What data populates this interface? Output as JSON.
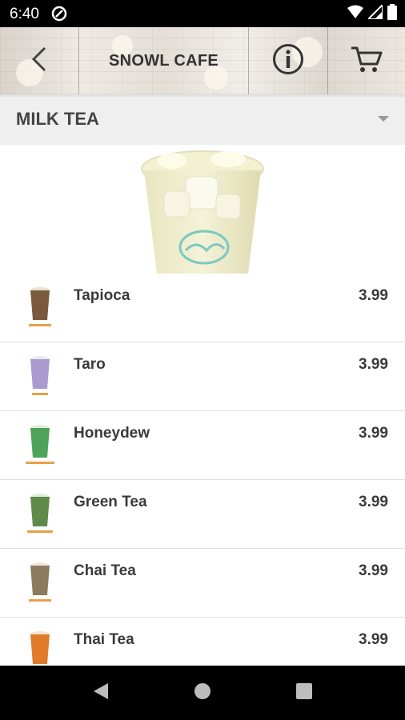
{
  "status_bar": {
    "time": "6:40"
  },
  "app_bar": {
    "title": "SNOWL CAFE",
    "back_icon": "chevron-left-icon",
    "info_icon": "info-icon",
    "cart_icon": "cart-icon"
  },
  "category": {
    "label": "MILK TEA",
    "dropdown_icon": "dropdown-arrow-icon"
  },
  "menu_items": [
    {
      "name": "Tapioca",
      "price": "3.99",
      "color": "#7a5a3c"
    },
    {
      "name": "Taro",
      "price": "3.99",
      "color": "#a99bd0"
    },
    {
      "name": "Honeydew",
      "price": "3.99",
      "color": "#4fa25a"
    },
    {
      "name": "Green Tea",
      "price": "3.99",
      "color": "#5f8a4a"
    },
    {
      "name": "Chai Tea",
      "price": "3.99",
      "color": "#8e7a5e"
    },
    {
      "name": "Thai Tea",
      "price": "3.99",
      "color": "#e07b2a"
    }
  ],
  "colors": {
    "status_bar": "#000000",
    "category_bar": "#efefef",
    "text_primary": "#3a3a3a"
  }
}
